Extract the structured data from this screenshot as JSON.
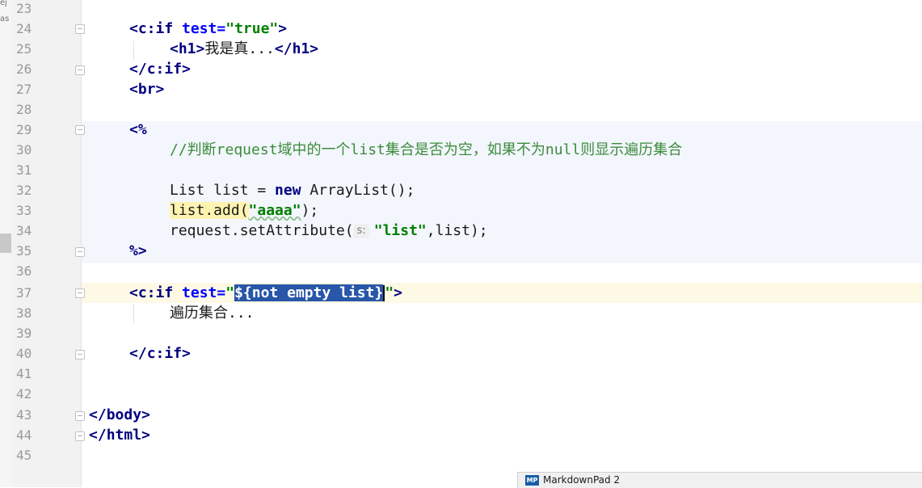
{
  "left_strip": {
    "fragments": [
      "ej",
      "as"
    ]
  },
  "editor": {
    "lines": [
      {
        "num": "23"
      },
      {
        "num": "24"
      },
      {
        "num": "25"
      },
      {
        "num": "26"
      },
      {
        "num": "27"
      },
      {
        "num": "28"
      },
      {
        "num": "29"
      },
      {
        "num": "30"
      },
      {
        "num": "31"
      },
      {
        "num": "32"
      },
      {
        "num": "33"
      },
      {
        "num": "34"
      },
      {
        "num": "35"
      },
      {
        "num": "36"
      },
      {
        "num": "37"
      },
      {
        "num": "38"
      },
      {
        "num": "39"
      },
      {
        "num": "40"
      },
      {
        "num": "41"
      },
      {
        "num": "42"
      },
      {
        "num": "43"
      },
      {
        "num": "44"
      },
      {
        "num": "45"
      }
    ],
    "code": {
      "l24": {
        "open": "<",
        "tag": "c:if",
        "sp": " ",
        "attr": "test",
        "eq": "=",
        "val": "\"true\"",
        "close": ">"
      },
      "l25": {
        "open": "<",
        "tag": "h1",
        "close": ">",
        "text": "我是真...",
        "end_open": "</",
        "end_tag": "h1",
        "end_close": ">"
      },
      "l26": {
        "open": "</",
        "tag": "c:if",
        "close": ">"
      },
      "l27": {
        "open": "<",
        "tag": "br",
        "close": ">"
      },
      "l29": {
        "text": "<%"
      },
      "l30": {
        "comment": "//判断request域中的一个list集合是否为空，如果不为null则显示遍历集合"
      },
      "l32": {
        "pre": "List list = ",
        "kw": "new",
        "post": " ArrayList();"
      },
      "l33": {
        "pre": "list.add(",
        "str": "\"aaaa\"",
        "post": ");"
      },
      "l34": {
        "pre": "request.setAttribute(",
        "hint": "s:",
        "str": "\"list\"",
        "post": ",list);"
      },
      "l35": {
        "text": "%>"
      },
      "l37": {
        "open": "<",
        "tag": "c:if",
        "sp": " ",
        "attr": "test",
        "eq": "=",
        "q1": "\"",
        "selected": "${not empty list}",
        "q2": "\"",
        "close": ">"
      },
      "l38": {
        "text": "遍历集合..."
      },
      "l40": {
        "open": "</",
        "tag": "c:if",
        "close": ">"
      },
      "l43": {
        "open": "</",
        "tag": "body",
        "close": ">"
      },
      "l44": {
        "open": "</",
        "tag": "html",
        "close": ">"
      }
    }
  },
  "taskbar": {
    "app_logo": "MP",
    "app_label": "MarkdownPad 2"
  },
  "colors": {
    "tag": "#000080",
    "attr": "#0000ff",
    "string": "#008000",
    "comment": "#3c8b3c",
    "selection": "#2856a8",
    "scriptlet_bg": "#f3f6fc",
    "current_line": "#fdf9e5"
  }
}
